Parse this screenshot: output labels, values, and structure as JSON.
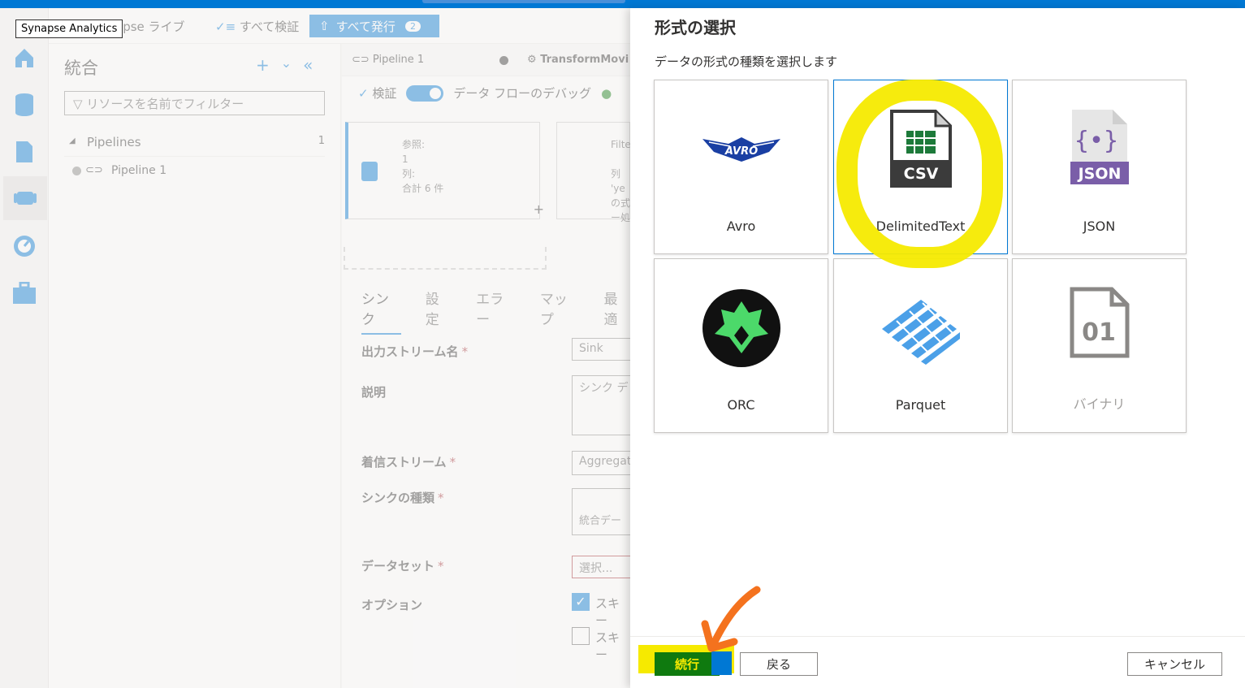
{
  "tooltip": "Synapse Analytics",
  "toolbar": {
    "library": "apse ライブ",
    "validate_all": "すべて検証",
    "publish_all": "すべて発行",
    "publish_count": "2"
  },
  "resources": {
    "title": "統合",
    "filter_placeholder": "リソースを名前でフィルター",
    "group": "Pipelines",
    "group_count": "1",
    "item": "Pipeline 1"
  },
  "canvas": {
    "tab1": "Pipeline 1",
    "tab2": "TransformMovi",
    "validate": "検証",
    "debug": "データ フローのデバッグ",
    "node1": [
      "参照:",
      "1",
      "列:",
      "合計 6 件"
    ],
    "node2": [
      "Filte",
      "列 'ye",
      "の式",
      "ー処"
    ],
    "subtabs": [
      "シンク",
      "設定",
      "エラー",
      "マップ",
      "最適"
    ],
    "fields": {
      "output_name": "出力ストリーム名",
      "output_value": "Sink",
      "description": "説明",
      "description_value": "シンク デ",
      "incoming": "着信ストリーム",
      "incoming_value": "Aggregat",
      "sink_type": "シンクの種類",
      "sink_type_value": "統合デー",
      "dataset": "データセット",
      "dataset_value": "選択...",
      "options": "オプション",
      "option1": "スキー",
      "option2": "スキー"
    }
  },
  "panel": {
    "title": "形式の選択",
    "subtitle": "データの形式の種類を選択します",
    "formats": [
      {
        "label": "Avro",
        "icon": "avro-icon",
        "selected": false
      },
      {
        "label": "DelimitedText",
        "icon": "csv-icon",
        "selected": true
      },
      {
        "label": "JSON",
        "icon": "json-icon",
        "selected": false
      },
      {
        "label": "ORC",
        "icon": "orc-icon",
        "selected": false
      },
      {
        "label": "Parquet",
        "icon": "parquet-icon",
        "selected": false
      },
      {
        "label": "バイナリ",
        "icon": "binary-icon",
        "selected": false
      }
    ],
    "icon_text": {
      "avro": "AVRO",
      "csv": "CSV",
      "json": "JSON",
      "binary": "01"
    },
    "buttons": {
      "continue": "続行",
      "back": "戻る",
      "cancel": "キャンセル"
    }
  },
  "colors": {
    "accent": "#0078d4",
    "highlight": "#f6ea00",
    "continue_bg": "#0f7a0f",
    "annotation_arrow": "#f4721e"
  }
}
